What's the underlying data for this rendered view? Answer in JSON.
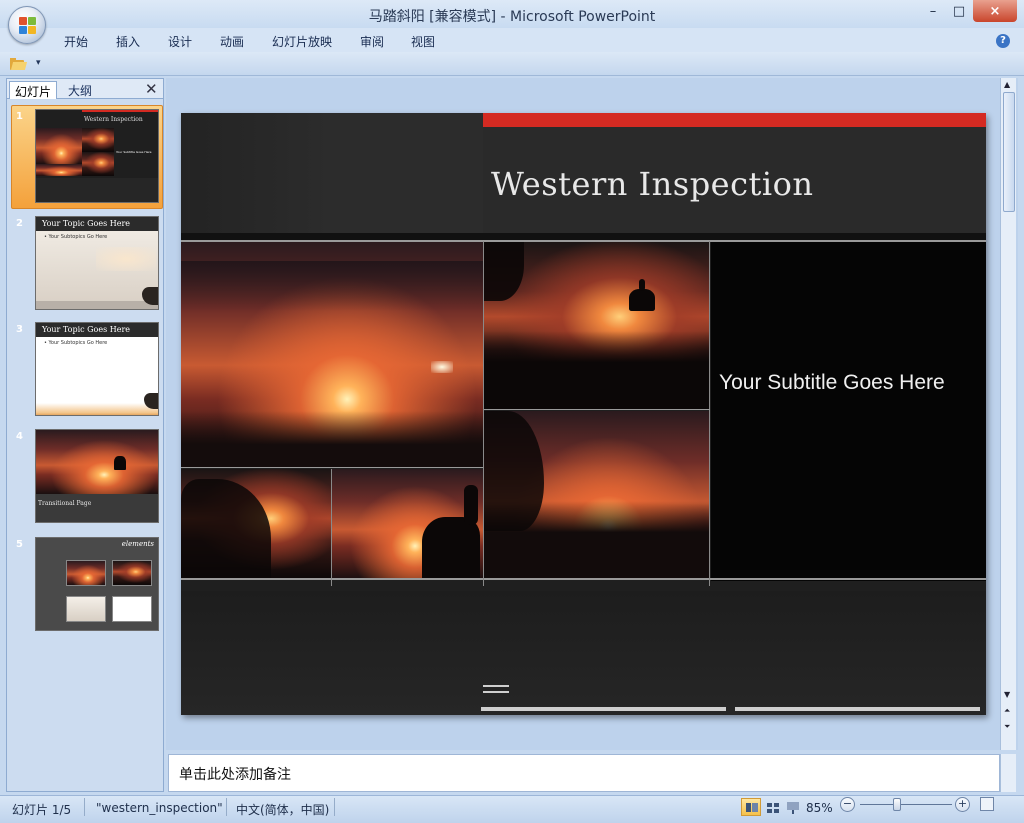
{
  "window": {
    "title": "马踏斜阳 [兼容模式] - Microsoft PowerPoint",
    "minimize": "–",
    "maximize": "□",
    "close": "×"
  },
  "ribbon": {
    "tabs": [
      "开始",
      "插入",
      "设计",
      "动画",
      "幻灯片放映",
      "审阅",
      "视图"
    ],
    "help": "?"
  },
  "quick_access": {
    "dropdown": "▾"
  },
  "left_pane": {
    "tabs": [
      "幻灯片",
      "大纲"
    ],
    "close": "✕",
    "thumbnails": [
      {
        "number": "1",
        "title": "Western Inspection",
        "subtitle": "Your Subtitle Goes Here",
        "selected": true
      },
      {
        "number": "2",
        "title": "Your Topic Goes Here",
        "subtitle": "• Your Subtopics Go Here"
      },
      {
        "number": "3",
        "title": "Your Topic Goes Here",
        "subtitle": "• Your Subtopics Go Here"
      },
      {
        "number": "4",
        "title": "Transitional Page"
      },
      {
        "number": "5",
        "title": "elements"
      }
    ]
  },
  "slide": {
    "title": "Western Inspection",
    "subtitle": "Your Subtitle Goes Here"
  },
  "notes": {
    "placeholder": "单击此处添加备注"
  },
  "status": {
    "slide_pos": "幻灯片 1/5",
    "theme": "\"western_inspection\"",
    "language": "中文(简体，中国)",
    "zoom": "85%",
    "zoom_minus": "−",
    "zoom_plus": "+",
    "zoom_percent": 85
  },
  "colors": {
    "accent_red": "#d42a22",
    "slide_bg": "#1f1f1f",
    "selection": "#f4a13b"
  }
}
